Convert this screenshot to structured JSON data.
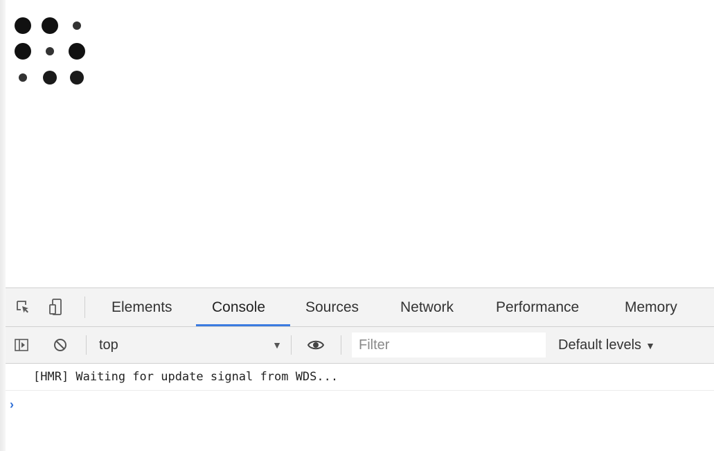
{
  "page": {
    "dots": [
      {
        "size": "big"
      },
      {
        "size": "big"
      },
      {
        "size": "small"
      },
      {
        "size": "big"
      },
      {
        "size": "small"
      },
      {
        "size": "big"
      },
      {
        "size": "small"
      },
      {
        "size": "mid"
      },
      {
        "size": "mid"
      }
    ]
  },
  "devtools": {
    "icons": {
      "inspect": "inspect-element-icon",
      "device": "device-toolbar-icon",
      "sidebar": "show-console-sidebar-icon",
      "clear": "clear-console-icon",
      "eye": "live-expression-eye-icon"
    },
    "tabs": [
      {
        "label": "Elements",
        "active": false
      },
      {
        "label": "Console",
        "active": true
      },
      {
        "label": "Sources",
        "active": false
      },
      {
        "label": "Network",
        "active": false
      },
      {
        "label": "Performance",
        "active": false
      },
      {
        "label": "Memory",
        "active": false
      }
    ],
    "toolbar": {
      "context": "top",
      "filter_placeholder": "Filter",
      "filter_value": "",
      "levels_label": "Default levels"
    },
    "console": {
      "messages": [
        {
          "text": "[HMR] Waiting for update signal from WDS..."
        }
      ],
      "prompt_symbol": "›"
    },
    "colors": {
      "accent": "#3b7be0",
      "prompt": "#2f6fd6",
      "toolbar_bg": "#f3f3f3"
    }
  }
}
